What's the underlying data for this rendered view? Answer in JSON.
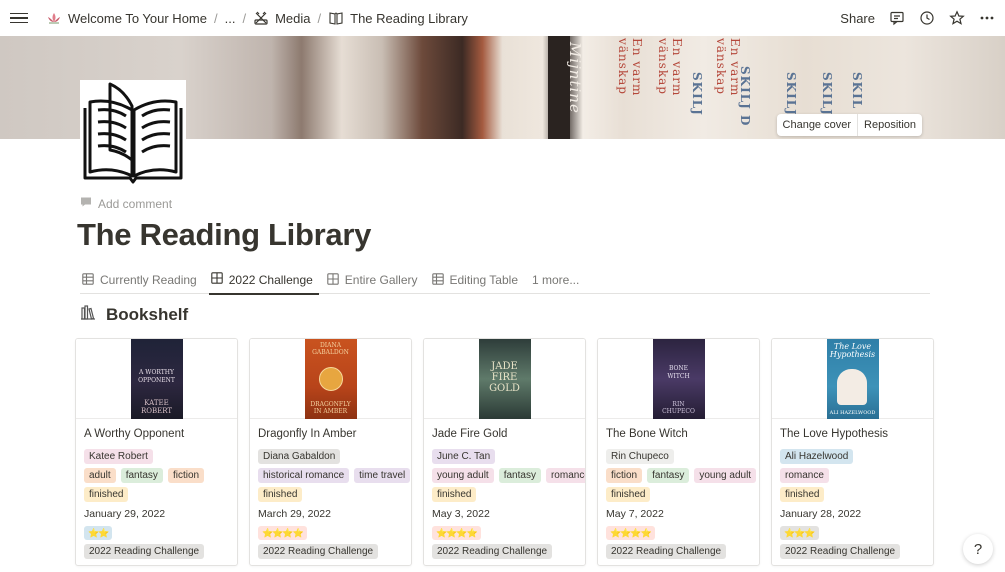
{
  "breadcrumb": {
    "items": [
      {
        "label": "Welcome To Your Home",
        "icon": "lotus-icon"
      },
      {
        "label": "...",
        "icon": ""
      },
      {
        "label": "Media",
        "icon": "film-icon"
      },
      {
        "label": "The Reading Library",
        "icon": "book-icon"
      }
    ]
  },
  "topbar": {
    "share_label": "Share"
  },
  "cover": {
    "change_cover_label": "Change cover",
    "reposition_label": "Reposition",
    "spine_texts": [
      "Mijntine",
      "En varm vänskap",
      "En varm vänskap",
      "SKILJ",
      "En varm vänskap",
      "SKILJ D",
      "SKILJ",
      "SKILJ",
      "SKIL"
    ]
  },
  "page": {
    "add_comment_label": "Add comment",
    "title": "The Reading Library"
  },
  "tabs": [
    {
      "label": "Currently Reading",
      "icon": "table-icon",
      "active": false
    },
    {
      "label": "2022 Challenge",
      "icon": "gallery-icon",
      "active": true
    },
    {
      "label": "Entire Gallery",
      "icon": "gallery-icon",
      "active": false
    },
    {
      "label": "Editing Table",
      "icon": "table-icon",
      "active": false
    },
    {
      "label": "1 more...",
      "icon": "",
      "active": false
    }
  ],
  "section": {
    "title": "Bookshelf",
    "icon": "bookshelf-icon"
  },
  "books": [
    {
      "title": "A Worthy Opponent",
      "author": "Katee Robert",
      "genres": [
        "adult",
        "fantasy",
        "fiction"
      ],
      "status": "finished",
      "date": "January 29, 2022",
      "rating": "⭐⭐",
      "challenge": "2022 Reading Challenge",
      "cover_text": [
        "A WORTHY",
        "OPPONENT",
        "KATEE",
        "ROBERT"
      ]
    },
    {
      "title": "Dragonfly In Amber",
      "author": "Diana Gabaldon",
      "genres": [
        "historical romance",
        "time travel"
      ],
      "status": "finished",
      "date": "March 29, 2022",
      "rating": "⭐⭐⭐⭐",
      "challenge": "2022 Reading Challenge",
      "cover_text": [
        "DIANA",
        "GABALDON",
        "DRAGONFLY",
        "IN AMBER"
      ]
    },
    {
      "title": "Jade Fire Gold",
      "author": "June C. Tan",
      "genres": [
        "young adult",
        "fantasy",
        "romance"
      ],
      "status": "finished",
      "date": "May 3, 2022",
      "rating": "⭐⭐⭐⭐",
      "challenge": "2022 Reading Challenge",
      "cover_text": [
        "JADE",
        "FIRE",
        "GOLD"
      ]
    },
    {
      "title": "The Bone Witch",
      "author": "Rin Chupeco",
      "genres": [
        "fiction",
        "fantasy",
        "young adult"
      ],
      "status": "finished",
      "date": "May 7, 2022",
      "rating": "⭐⭐⭐⭐",
      "challenge": "2022 Reading Challenge",
      "cover_text": [
        "BONE",
        "WITCH",
        "RIN",
        "CHUPECO"
      ]
    },
    {
      "title": "The Love Hypothesis",
      "author": "Ali Hazelwood",
      "genres": [
        "romance"
      ],
      "status": "finished",
      "date": "January 28, 2022",
      "rating": "⭐⭐⭐",
      "challenge": "2022 Reading Challenge",
      "cover_text": [
        "The Love",
        "Hypothesis",
        "ALI",
        "HAZELWOOD"
      ]
    }
  ],
  "colors": {
    "author_tag": [
      "#f5e0e9",
      "#e3e2e0",
      "#e8deee",
      "#eeeeec",
      "#d3e5ef"
    ],
    "genre_tags": {
      "adult": "#fadec9",
      "fantasy": "#dbeddb",
      "fiction": "#fadec9",
      "historical romance": "#e8deee",
      "time travel": "#e8deee",
      "young adult": "#f5e0e9",
      "romance": "#f5e0e9"
    },
    "status_tag": "#fdecc8",
    "stars_bg": [
      "#d3e5ef",
      "#ffe2dd",
      "#ffe2dd",
      "#ffe2dd",
      "#e3e2e0"
    ],
    "challenge_tag": "#e3e2e0"
  },
  "help": {
    "label": "?"
  }
}
